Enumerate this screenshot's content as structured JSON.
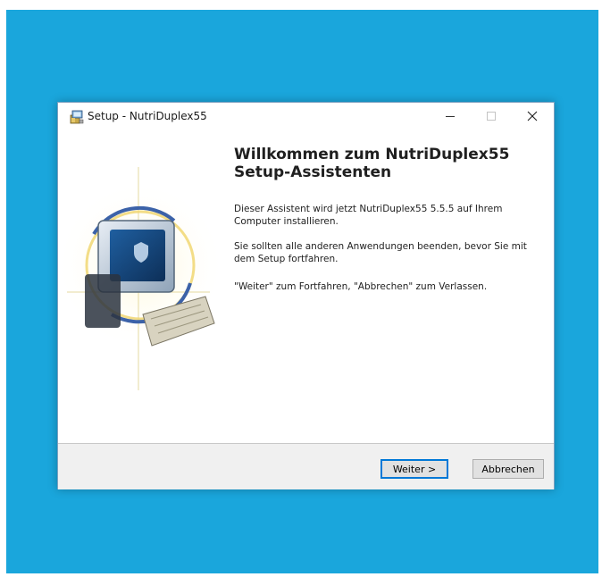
{
  "window": {
    "title": "Setup - NutriDuplex55",
    "minimize_glyph": "—",
    "maximize_glyph": "☐",
    "close_glyph": "✕"
  },
  "content": {
    "heading_line1": "Willkommen zum NutriDuplex55",
    "heading_line2": "Setup-Assistenten",
    "paragraph1": "Dieser Assistent wird jetzt NutriDuplex55 5.5.5 auf Ihrem Computer installieren.",
    "paragraph2": "Sie sollten alle anderen Anwendungen beenden, bevor Sie mit dem Setup fortfahren.",
    "paragraph3": "\"Weiter\" zum Fortfahren, \"Abbrechen\" zum Verlassen."
  },
  "buttons": {
    "next_label": "Weiter >",
    "cancel_label": "Abbrechen"
  },
  "icons": {
    "app": "setup-installer-icon",
    "banner": "computer-install-wizard-icon"
  },
  "colors": {
    "desktop": "#1aa6dc",
    "focus_border": "#0078d7"
  }
}
